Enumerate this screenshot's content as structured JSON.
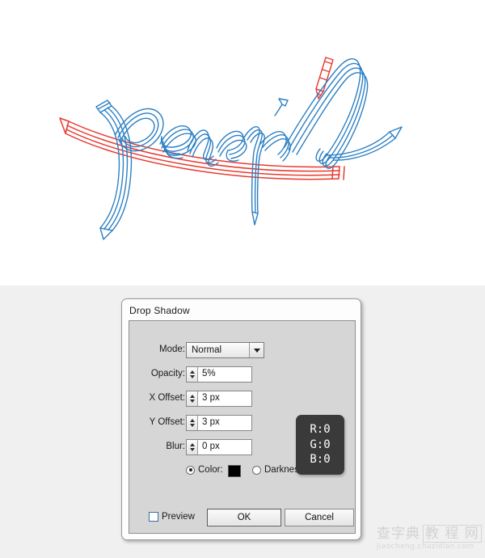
{
  "artwork": {
    "title": "pencil-lettering-artwork",
    "word": "pencil",
    "blue_color": "#2b7fc4",
    "red_color": "#e8392f",
    "canvas_color": "#ffffff"
  },
  "dialog": {
    "title": "Drop Shadow",
    "fields": [
      {
        "id": "mode",
        "label": "Mode:",
        "value": "Normal",
        "type": "select"
      },
      {
        "id": "opacity",
        "label": "Opacity:",
        "value": "5%",
        "type": "spinner"
      },
      {
        "id": "x_offset",
        "label": "X Offset:",
        "value": "3 px",
        "type": "spinner"
      },
      {
        "id": "y_offset",
        "label": "Y Offset:",
        "value": "3 px",
        "type": "spinner"
      },
      {
        "id": "blur",
        "label": "Blur:",
        "value": "0 px",
        "type": "spinner"
      }
    ],
    "mode_options": [
      "Normal"
    ],
    "radios": {
      "color": {
        "label": "Color:",
        "selected": true,
        "swatch_hex": "#000000"
      },
      "darkness": {
        "label": "Darkness:",
        "selected": false
      }
    },
    "preview": {
      "label": "Preview",
      "checked": false
    },
    "buttons": {
      "ok": "OK",
      "cancel": "Cancel"
    }
  },
  "tooltip": {
    "r": "R:0",
    "g": "G:0",
    "b": "B:0",
    "background": "#3a3a3a"
  },
  "watermark": {
    "brand": "查字典",
    "brand_boxed": "教 程 网",
    "url": "jiaocheng.chazidian.com"
  }
}
